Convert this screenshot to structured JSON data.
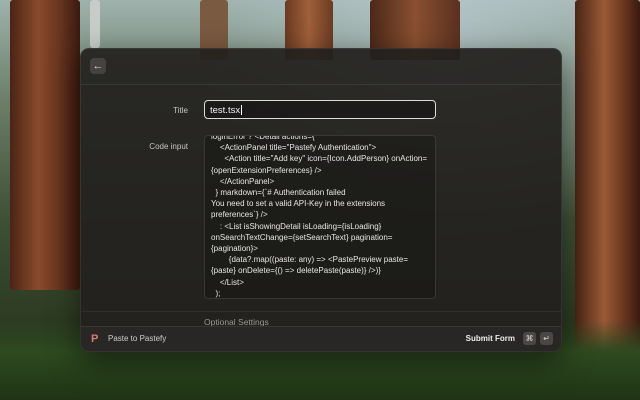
{
  "form": {
    "title_label": "Title",
    "title_value": "test.tsx",
    "code_label": "Code input",
    "code_value": "loginError ? <Detail actions={\n    <ActionPanel title=\"Pastefy Authentication\">\n      <Action title=\"Add key\" icon={Icon.AddPerson} onAction={openExtensionPreferences} />\n    </ActionPanel>\n  } markdown={`# Authentication failed\nYou need to set a valid API-Key in the extensions preferences`} />\n    : <List isShowingDetail isLoading={isLoading} onSearchTextChange={setSearchText} pagination={pagination}>\n        {data?.map((paste: any) => <PastePreview paste={paste} onDelete={() => deletePaste(paste)} />)}\n    </List>\n  );\n}",
    "optional_settings": "Optional Settings"
  },
  "toolbar": {
    "back_icon": "←"
  },
  "footer": {
    "extension_icon": "P",
    "extension_name": "Paste to Pastefy",
    "submit_label": "Submit Form",
    "kbd_cmd": "⌘",
    "kbd_return": "↵"
  },
  "colors": {
    "accent": "#e07a6e"
  }
}
